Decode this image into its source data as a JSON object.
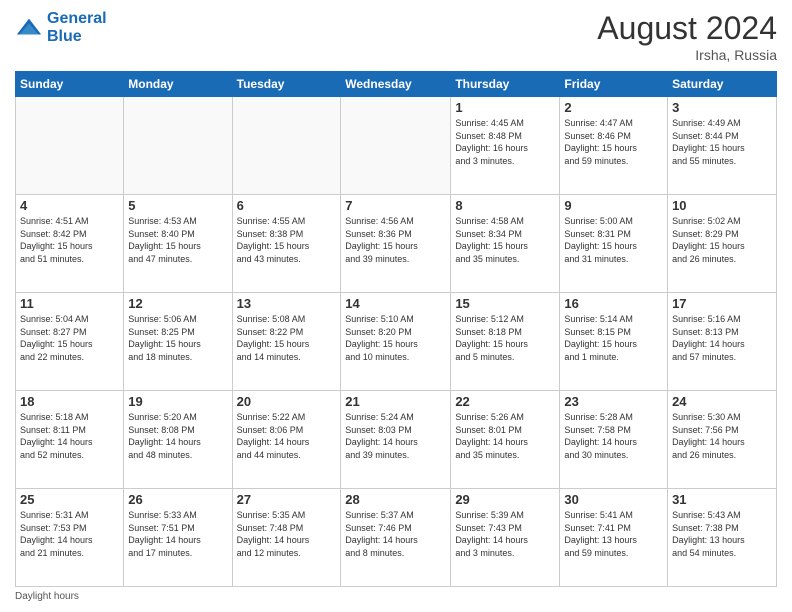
{
  "header": {
    "logo_line1": "General",
    "logo_line2": "Blue",
    "month_title": "August 2024",
    "location": "Irsha, Russia"
  },
  "weekdays": [
    "Sunday",
    "Monday",
    "Tuesday",
    "Wednesday",
    "Thursday",
    "Friday",
    "Saturday"
  ],
  "weeks": [
    [
      {
        "day": "",
        "info": ""
      },
      {
        "day": "",
        "info": ""
      },
      {
        "day": "",
        "info": ""
      },
      {
        "day": "",
        "info": ""
      },
      {
        "day": "1",
        "info": "Sunrise: 4:45 AM\nSunset: 8:48 PM\nDaylight: 16 hours\nand 3 minutes."
      },
      {
        "day": "2",
        "info": "Sunrise: 4:47 AM\nSunset: 8:46 PM\nDaylight: 15 hours\nand 59 minutes."
      },
      {
        "day": "3",
        "info": "Sunrise: 4:49 AM\nSunset: 8:44 PM\nDaylight: 15 hours\nand 55 minutes."
      }
    ],
    [
      {
        "day": "4",
        "info": "Sunrise: 4:51 AM\nSunset: 8:42 PM\nDaylight: 15 hours\nand 51 minutes."
      },
      {
        "day": "5",
        "info": "Sunrise: 4:53 AM\nSunset: 8:40 PM\nDaylight: 15 hours\nand 47 minutes."
      },
      {
        "day": "6",
        "info": "Sunrise: 4:55 AM\nSunset: 8:38 PM\nDaylight: 15 hours\nand 43 minutes."
      },
      {
        "day": "7",
        "info": "Sunrise: 4:56 AM\nSunset: 8:36 PM\nDaylight: 15 hours\nand 39 minutes."
      },
      {
        "day": "8",
        "info": "Sunrise: 4:58 AM\nSunset: 8:34 PM\nDaylight: 15 hours\nand 35 minutes."
      },
      {
        "day": "9",
        "info": "Sunrise: 5:00 AM\nSunset: 8:31 PM\nDaylight: 15 hours\nand 31 minutes."
      },
      {
        "day": "10",
        "info": "Sunrise: 5:02 AM\nSunset: 8:29 PM\nDaylight: 15 hours\nand 26 minutes."
      }
    ],
    [
      {
        "day": "11",
        "info": "Sunrise: 5:04 AM\nSunset: 8:27 PM\nDaylight: 15 hours\nand 22 minutes."
      },
      {
        "day": "12",
        "info": "Sunrise: 5:06 AM\nSunset: 8:25 PM\nDaylight: 15 hours\nand 18 minutes."
      },
      {
        "day": "13",
        "info": "Sunrise: 5:08 AM\nSunset: 8:22 PM\nDaylight: 15 hours\nand 14 minutes."
      },
      {
        "day": "14",
        "info": "Sunrise: 5:10 AM\nSunset: 8:20 PM\nDaylight: 15 hours\nand 10 minutes."
      },
      {
        "day": "15",
        "info": "Sunrise: 5:12 AM\nSunset: 8:18 PM\nDaylight: 15 hours\nand 5 minutes."
      },
      {
        "day": "16",
        "info": "Sunrise: 5:14 AM\nSunset: 8:15 PM\nDaylight: 15 hours\nand 1 minute."
      },
      {
        "day": "17",
        "info": "Sunrise: 5:16 AM\nSunset: 8:13 PM\nDaylight: 14 hours\nand 57 minutes."
      }
    ],
    [
      {
        "day": "18",
        "info": "Sunrise: 5:18 AM\nSunset: 8:11 PM\nDaylight: 14 hours\nand 52 minutes."
      },
      {
        "day": "19",
        "info": "Sunrise: 5:20 AM\nSunset: 8:08 PM\nDaylight: 14 hours\nand 48 minutes."
      },
      {
        "day": "20",
        "info": "Sunrise: 5:22 AM\nSunset: 8:06 PM\nDaylight: 14 hours\nand 44 minutes."
      },
      {
        "day": "21",
        "info": "Sunrise: 5:24 AM\nSunset: 8:03 PM\nDaylight: 14 hours\nand 39 minutes."
      },
      {
        "day": "22",
        "info": "Sunrise: 5:26 AM\nSunset: 8:01 PM\nDaylight: 14 hours\nand 35 minutes."
      },
      {
        "day": "23",
        "info": "Sunrise: 5:28 AM\nSunset: 7:58 PM\nDaylight: 14 hours\nand 30 minutes."
      },
      {
        "day": "24",
        "info": "Sunrise: 5:30 AM\nSunset: 7:56 PM\nDaylight: 14 hours\nand 26 minutes."
      }
    ],
    [
      {
        "day": "25",
        "info": "Sunrise: 5:31 AM\nSunset: 7:53 PM\nDaylight: 14 hours\nand 21 minutes."
      },
      {
        "day": "26",
        "info": "Sunrise: 5:33 AM\nSunset: 7:51 PM\nDaylight: 14 hours\nand 17 minutes."
      },
      {
        "day": "27",
        "info": "Sunrise: 5:35 AM\nSunset: 7:48 PM\nDaylight: 14 hours\nand 12 minutes."
      },
      {
        "day": "28",
        "info": "Sunrise: 5:37 AM\nSunset: 7:46 PM\nDaylight: 14 hours\nand 8 minutes."
      },
      {
        "day": "29",
        "info": "Sunrise: 5:39 AM\nSunset: 7:43 PM\nDaylight: 14 hours\nand 3 minutes."
      },
      {
        "day": "30",
        "info": "Sunrise: 5:41 AM\nSunset: 7:41 PM\nDaylight: 13 hours\nand 59 minutes."
      },
      {
        "day": "31",
        "info": "Sunrise: 5:43 AM\nSunset: 7:38 PM\nDaylight: 13 hours\nand 54 minutes."
      }
    ]
  ],
  "footer": {
    "daylight_label": "Daylight hours"
  }
}
